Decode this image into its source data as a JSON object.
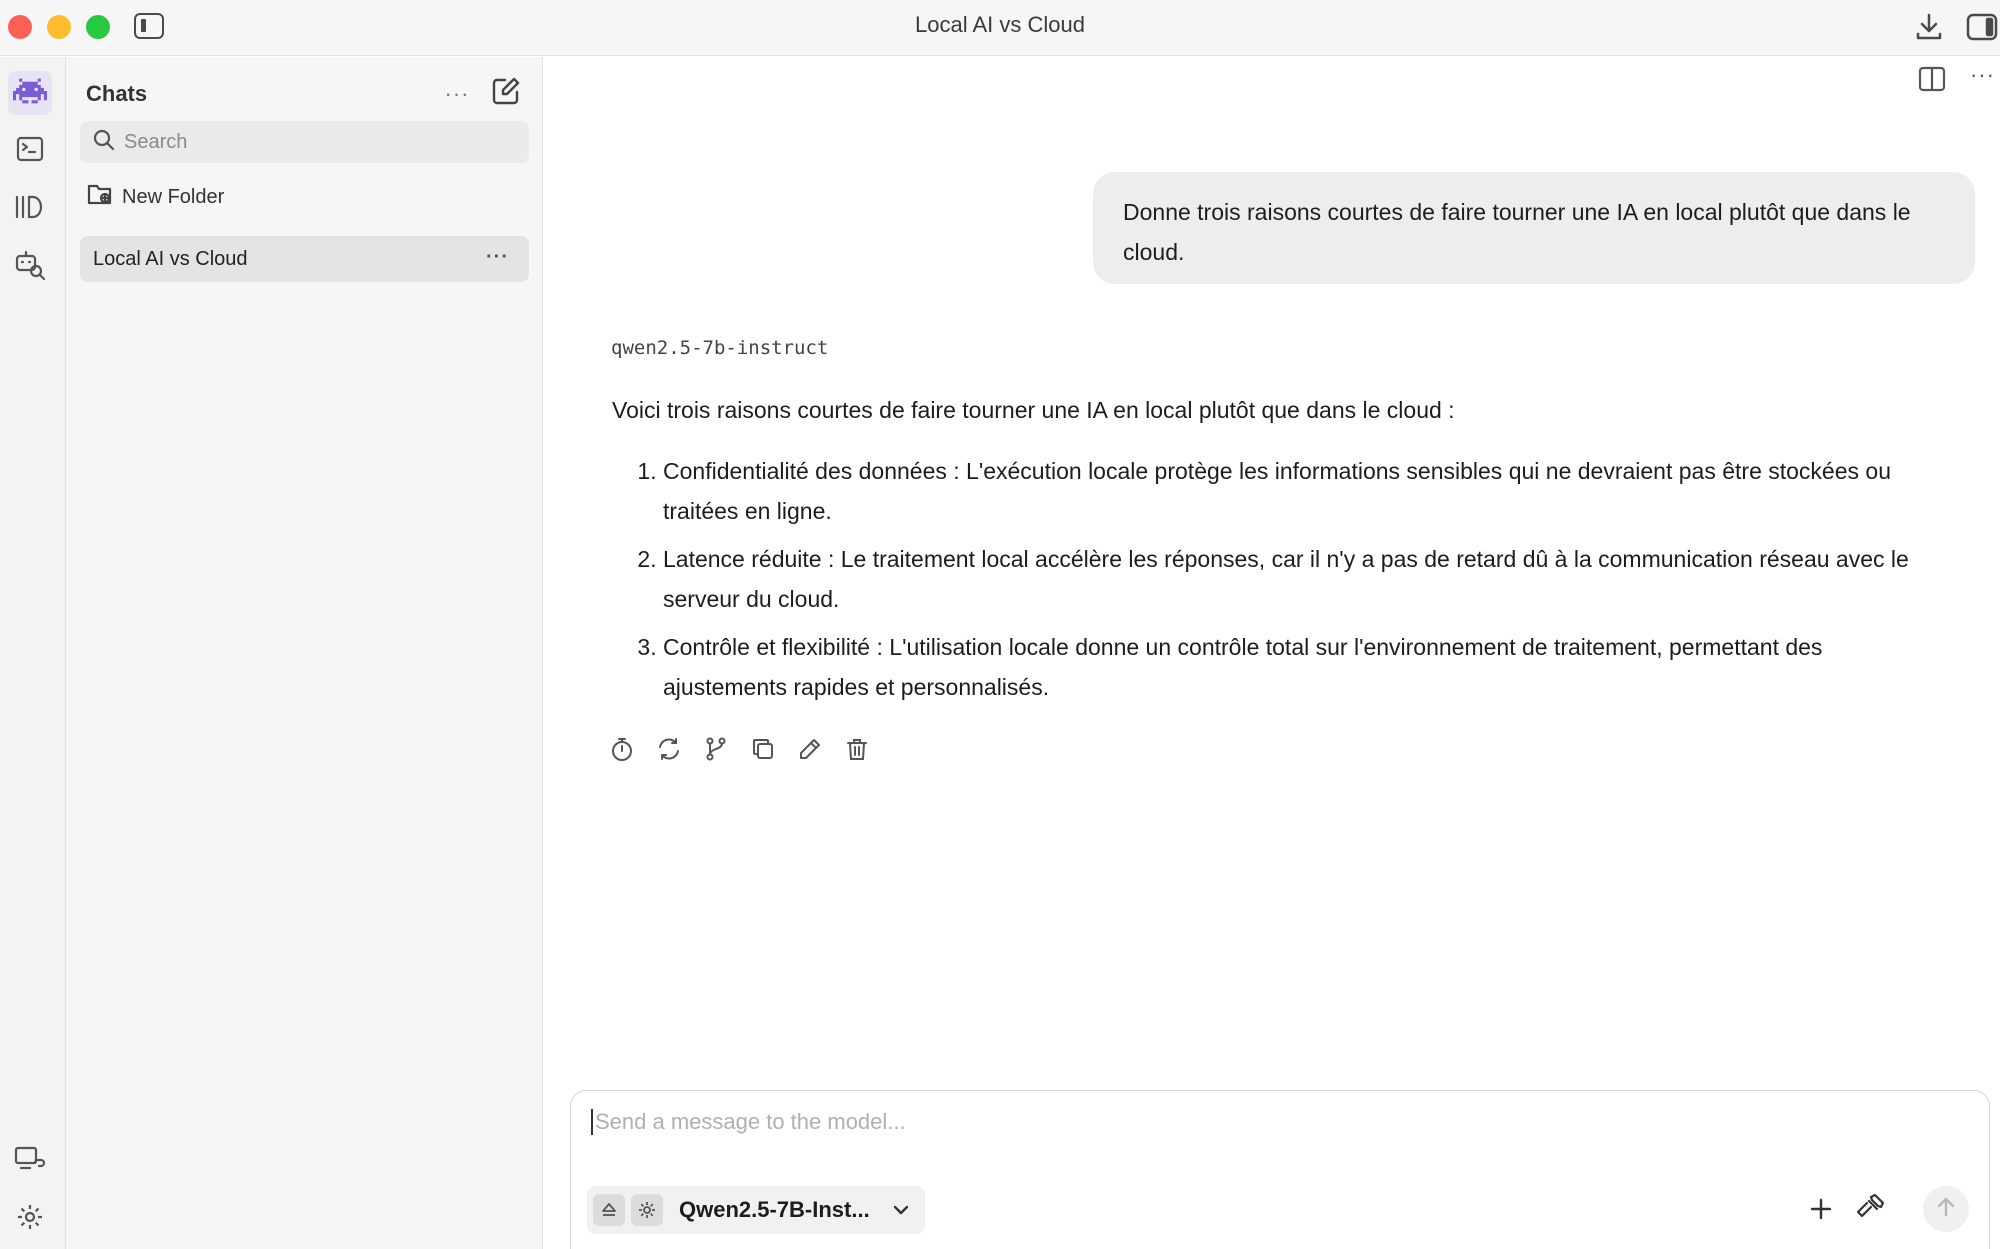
{
  "window": {
    "title": "Local AI vs Cloud"
  },
  "sidebar": {
    "title": "Chats",
    "more_label": "···",
    "search_placeholder": "Search",
    "new_folder_label": "New Folder",
    "chats": [
      {
        "label": "Local AI vs Cloud",
        "more_label": "···",
        "selected": true
      }
    ]
  },
  "conversation": {
    "user_message": "Donne trois raisons courtes de faire tourner une IA en local plutôt que dans le cloud.",
    "model_name": "qwen2.5-7b-instruct",
    "answer_intro": "Voici trois raisons courtes de faire tourner une IA en local plutôt que dans le cloud :",
    "answer_points": [
      "Confidentialité des données : L'exécution locale protège les informations sensibles qui ne devraient pas être stockées ou traitées en ligne.",
      "Latence réduite : Le traitement local accélère les réponses, car il n'y a pas de retard dû à la communication réseau avec le serveur du cloud.",
      "Contrôle et flexibilité : L'utilisation locale donne un contrôle total sur l'environnement de traitement, permettant des ajustements rapides et personnalisés."
    ]
  },
  "main": {
    "more_label": "···"
  },
  "composer": {
    "placeholder": "Send a message to the model...",
    "model_label": "Qwen2.5-7B-Inst..."
  },
  "colors": {
    "accent": "#7b5cd6",
    "user_bubble": "#eeeded",
    "sidebar_bg": "#f7f6f6"
  }
}
